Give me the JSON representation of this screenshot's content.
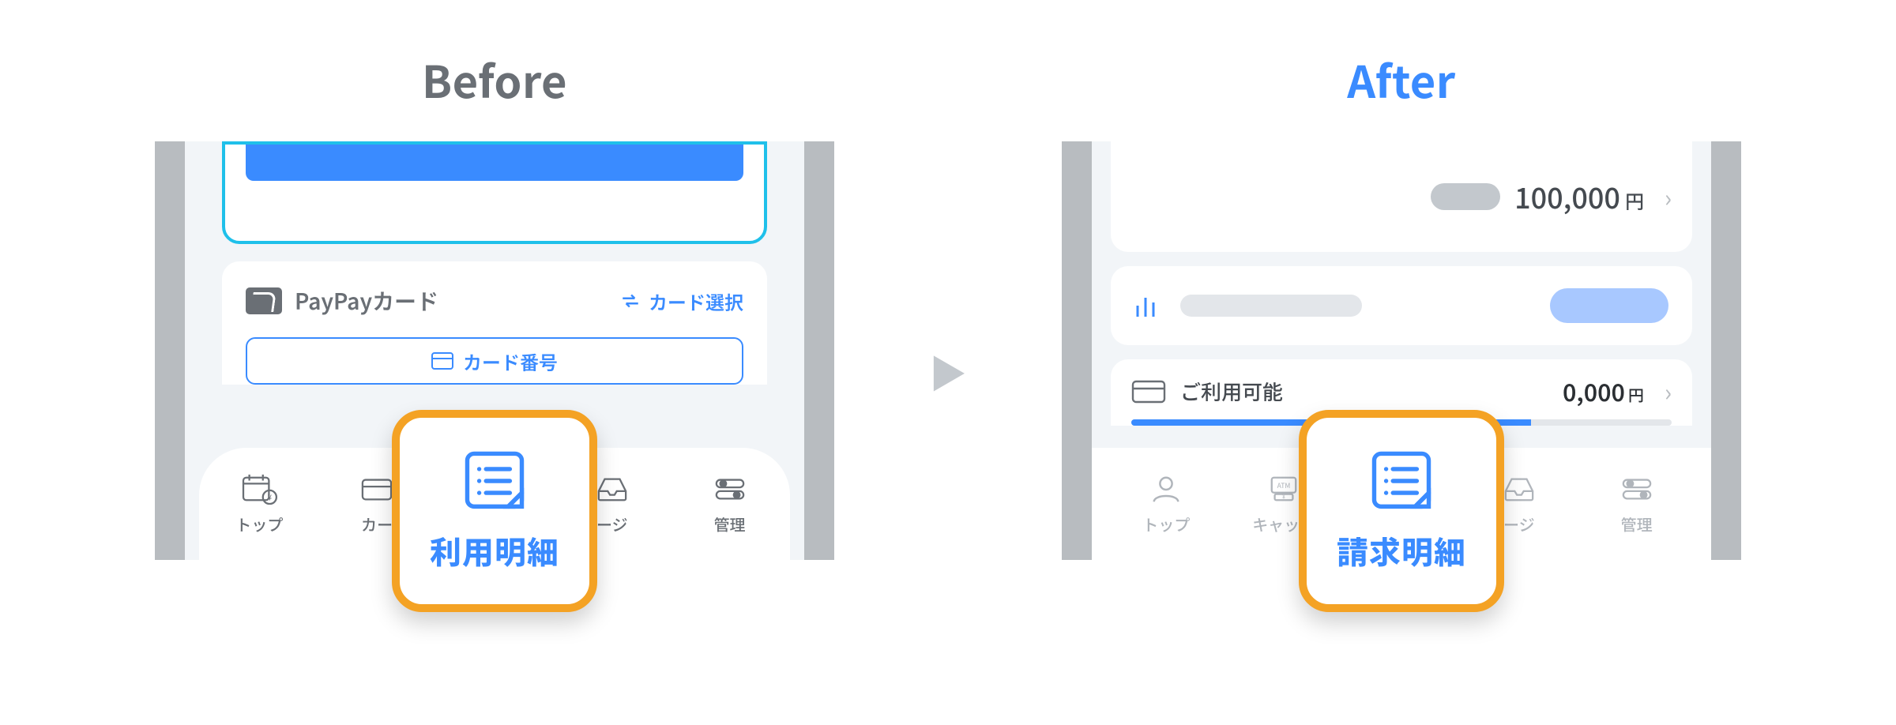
{
  "headings": {
    "before": "Before",
    "after": "After"
  },
  "before": {
    "brand_name": "PayPayカード",
    "switch_label": "カード選択",
    "card_number_label": "カード番号",
    "tabs": [
      "トップ",
      "カー",
      "ージ",
      "管理"
    ],
    "callout_label": "利用明細"
  },
  "after": {
    "row1_amount": "100,000",
    "row1_unit": "円",
    "row3_label": "ご利用可能",
    "row3_amount_partial": "0,000",
    "row3_unit": "円",
    "tabs": [
      "トップ",
      "キャッシ",
      "ージ",
      "管理"
    ],
    "callout_label": "請求明細"
  }
}
